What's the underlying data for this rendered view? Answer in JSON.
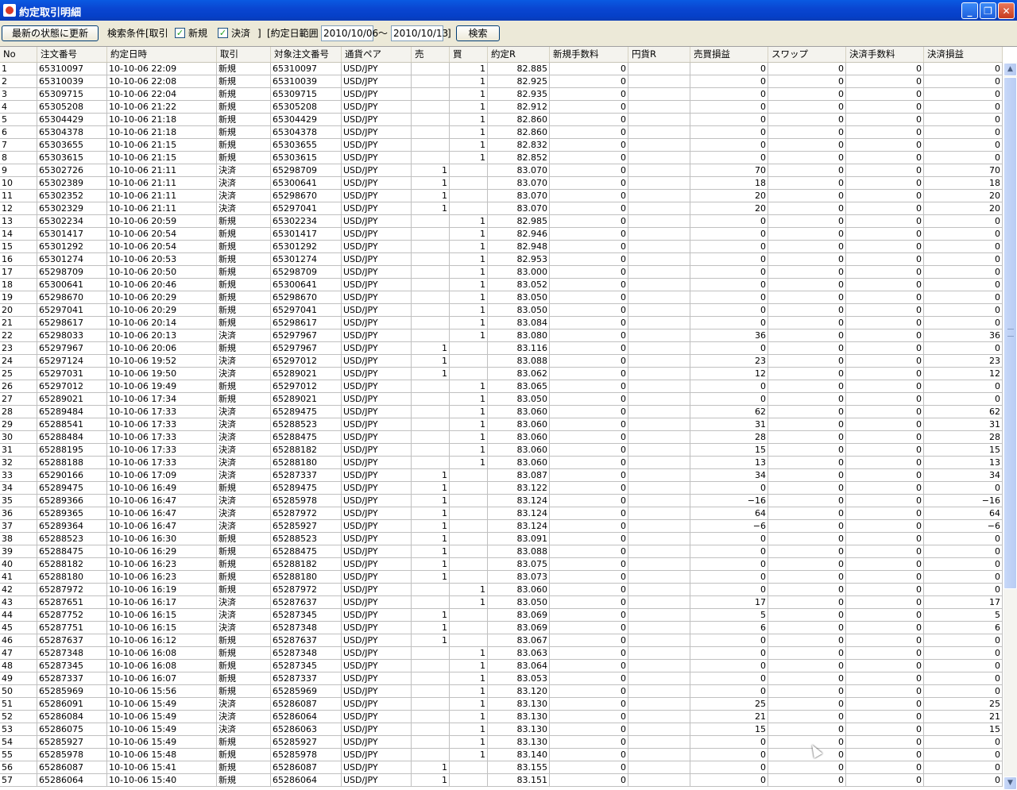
{
  "window": {
    "title": "約定取引明細",
    "minimize": "_",
    "maximize": "❐",
    "close": "✕"
  },
  "toolbar": {
    "refresh_label": "最新の状態に更新",
    "criteria_label": "検索条件[取引",
    "new_label": "新規",
    "settle_label": "決済",
    "bracket_close": "]",
    "date_range_label": "[約定日範囲",
    "date_from": "2010/10/06",
    "tilde": "～",
    "date_to": "2010/10/13",
    "bracket_close2": "]",
    "search_label": "検索"
  },
  "table": {
    "headers": [
      "No",
      "注文番号",
      "約定日時",
      "取引",
      "対象注文番号",
      "通貨ペア",
      "売",
      "買",
      "約定R",
      "新規手数料",
      "円貨R",
      "売買損益",
      "スワップ",
      "決済手数料",
      "決済損益"
    ],
    "rows": [
      [
        "1",
        "65310097",
        "10-10-06 22:09",
        "新規",
        "65310097",
        "USD/JPY",
        "",
        "1",
        "82.885",
        "0",
        "",
        "0",
        "0",
        "0",
        "0"
      ],
      [
        "2",
        "65310039",
        "10-10-06 22:08",
        "新規",
        "65310039",
        "USD/JPY",
        "",
        "1",
        "82.925",
        "0",
        "",
        "0",
        "0",
        "0",
        "0"
      ],
      [
        "3",
        "65309715",
        "10-10-06 22:04",
        "新規",
        "65309715",
        "USD/JPY",
        "",
        "1",
        "82.935",
        "0",
        "",
        "0",
        "0",
        "0",
        "0"
      ],
      [
        "4",
        "65305208",
        "10-10-06 21:22",
        "新規",
        "65305208",
        "USD/JPY",
        "",
        "1",
        "82.912",
        "0",
        "",
        "0",
        "0",
        "0",
        "0"
      ],
      [
        "5",
        "65304429",
        "10-10-06 21:18",
        "新規",
        "65304429",
        "USD/JPY",
        "",
        "1",
        "82.860",
        "0",
        "",
        "0",
        "0",
        "0",
        "0"
      ],
      [
        "6",
        "65304378",
        "10-10-06 21:18",
        "新規",
        "65304378",
        "USD/JPY",
        "",
        "1",
        "82.860",
        "0",
        "",
        "0",
        "0",
        "0",
        "0"
      ],
      [
        "7",
        "65303655",
        "10-10-06 21:15",
        "新規",
        "65303655",
        "USD/JPY",
        "",
        "1",
        "82.832",
        "0",
        "",
        "0",
        "0",
        "0",
        "0"
      ],
      [
        "8",
        "65303615",
        "10-10-06 21:15",
        "新規",
        "65303615",
        "USD/JPY",
        "",
        "1",
        "82.852",
        "0",
        "",
        "0",
        "0",
        "0",
        "0"
      ],
      [
        "9",
        "65302726",
        "10-10-06 21:11",
        "決済",
        "65298709",
        "USD/JPY",
        "1",
        "",
        "83.070",
        "0",
        "",
        "70",
        "0",
        "0",
        "70"
      ],
      [
        "10",
        "65302389",
        "10-10-06 21:11",
        "決済",
        "65300641",
        "USD/JPY",
        "1",
        "",
        "83.070",
        "0",
        "",
        "18",
        "0",
        "0",
        "18"
      ],
      [
        "11",
        "65302352",
        "10-10-06 21:11",
        "決済",
        "65298670",
        "USD/JPY",
        "1",
        "",
        "83.070",
        "0",
        "",
        "20",
        "0",
        "0",
        "20"
      ],
      [
        "12",
        "65302329",
        "10-10-06 21:11",
        "決済",
        "65297041",
        "USD/JPY",
        "1",
        "",
        "83.070",
        "0",
        "",
        "20",
        "0",
        "0",
        "20"
      ],
      [
        "13",
        "65302234",
        "10-10-06 20:59",
        "新規",
        "65302234",
        "USD/JPY",
        "",
        "1",
        "82.985",
        "0",
        "",
        "0",
        "0",
        "0",
        "0"
      ],
      [
        "14",
        "65301417",
        "10-10-06 20:54",
        "新規",
        "65301417",
        "USD/JPY",
        "",
        "1",
        "82.946",
        "0",
        "",
        "0",
        "0",
        "0",
        "0"
      ],
      [
        "15",
        "65301292",
        "10-10-06 20:54",
        "新規",
        "65301292",
        "USD/JPY",
        "",
        "1",
        "82.948",
        "0",
        "",
        "0",
        "0",
        "0",
        "0"
      ],
      [
        "16",
        "65301274",
        "10-10-06 20:53",
        "新規",
        "65301274",
        "USD/JPY",
        "",
        "1",
        "82.953",
        "0",
        "",
        "0",
        "0",
        "0",
        "0"
      ],
      [
        "17",
        "65298709",
        "10-10-06 20:50",
        "新規",
        "65298709",
        "USD/JPY",
        "",
        "1",
        "83.000",
        "0",
        "",
        "0",
        "0",
        "0",
        "0"
      ],
      [
        "18",
        "65300641",
        "10-10-06 20:46",
        "新規",
        "65300641",
        "USD/JPY",
        "",
        "1",
        "83.052",
        "0",
        "",
        "0",
        "0",
        "0",
        "0"
      ],
      [
        "19",
        "65298670",
        "10-10-06 20:29",
        "新規",
        "65298670",
        "USD/JPY",
        "",
        "1",
        "83.050",
        "0",
        "",
        "0",
        "0",
        "0",
        "0"
      ],
      [
        "20",
        "65297041",
        "10-10-06 20:29",
        "新規",
        "65297041",
        "USD/JPY",
        "",
        "1",
        "83.050",
        "0",
        "",
        "0",
        "0",
        "0",
        "0"
      ],
      [
        "21",
        "65298617",
        "10-10-06 20:14",
        "新規",
        "65298617",
        "USD/JPY",
        "",
        "1",
        "83.084",
        "0",
        "",
        "0",
        "0",
        "0",
        "0"
      ],
      [
        "22",
        "65298033",
        "10-10-06 20:13",
        "決済",
        "65297967",
        "USD/JPY",
        "",
        "1",
        "83.080",
        "0",
        "",
        "36",
        "0",
        "0",
        "36"
      ],
      [
        "23",
        "65297967",
        "10-10-06 20:06",
        "新規",
        "65297967",
        "USD/JPY",
        "1",
        "",
        "83.116",
        "0",
        "",
        "0",
        "0",
        "0",
        "0"
      ],
      [
        "24",
        "65297124",
        "10-10-06 19:52",
        "決済",
        "65297012",
        "USD/JPY",
        "1",
        "",
        "83.088",
        "0",
        "",
        "23",
        "0",
        "0",
        "23"
      ],
      [
        "25",
        "65297031",
        "10-10-06 19:50",
        "決済",
        "65289021",
        "USD/JPY",
        "1",
        "",
        "83.062",
        "0",
        "",
        "12",
        "0",
        "0",
        "12"
      ],
      [
        "26",
        "65297012",
        "10-10-06 19:49",
        "新規",
        "65297012",
        "USD/JPY",
        "",
        "1",
        "83.065",
        "0",
        "",
        "0",
        "0",
        "0",
        "0"
      ],
      [
        "27",
        "65289021",
        "10-10-06 17:34",
        "新規",
        "65289021",
        "USD/JPY",
        "",
        "1",
        "83.050",
        "0",
        "",
        "0",
        "0",
        "0",
        "0"
      ],
      [
        "28",
        "65289484",
        "10-10-06 17:33",
        "決済",
        "65289475",
        "USD/JPY",
        "",
        "1",
        "83.060",
        "0",
        "",
        "62",
        "0",
        "0",
        "62"
      ],
      [
        "29",
        "65288541",
        "10-10-06 17:33",
        "決済",
        "65288523",
        "USD/JPY",
        "",
        "1",
        "83.060",
        "0",
        "",
        "31",
        "0",
        "0",
        "31"
      ],
      [
        "30",
        "65288484",
        "10-10-06 17:33",
        "決済",
        "65288475",
        "USD/JPY",
        "",
        "1",
        "83.060",
        "0",
        "",
        "28",
        "0",
        "0",
        "28"
      ],
      [
        "31",
        "65288195",
        "10-10-06 17:33",
        "決済",
        "65288182",
        "USD/JPY",
        "",
        "1",
        "83.060",
        "0",
        "",
        "15",
        "0",
        "0",
        "15"
      ],
      [
        "32",
        "65288188",
        "10-10-06 17:33",
        "決済",
        "65288180",
        "USD/JPY",
        "",
        "1",
        "83.060",
        "0",
        "",
        "13",
        "0",
        "0",
        "13"
      ],
      [
        "33",
        "65290166",
        "10-10-06 17:09",
        "決済",
        "65287337",
        "USD/JPY",
        "1",
        "",
        "83.087",
        "0",
        "",
        "34",
        "0",
        "0",
        "34"
      ],
      [
        "34",
        "65289475",
        "10-10-06 16:49",
        "新規",
        "65289475",
        "USD/JPY",
        "1",
        "",
        "83.122",
        "0",
        "",
        "0",
        "0",
        "0",
        "0"
      ],
      [
        "35",
        "65289366",
        "10-10-06 16:47",
        "決済",
        "65285978",
        "USD/JPY",
        "1",
        "",
        "83.124",
        "0",
        "",
        "−16",
        "0",
        "0",
        "−16"
      ],
      [
        "36",
        "65289365",
        "10-10-06 16:47",
        "決済",
        "65287972",
        "USD/JPY",
        "1",
        "",
        "83.124",
        "0",
        "",
        "64",
        "0",
        "0",
        "64"
      ],
      [
        "37",
        "65289364",
        "10-10-06 16:47",
        "決済",
        "65285927",
        "USD/JPY",
        "1",
        "",
        "83.124",
        "0",
        "",
        "−6",
        "0",
        "0",
        "−6"
      ],
      [
        "38",
        "65288523",
        "10-10-06 16:30",
        "新規",
        "65288523",
        "USD/JPY",
        "1",
        "",
        "83.091",
        "0",
        "",
        "0",
        "0",
        "0",
        "0"
      ],
      [
        "39",
        "65288475",
        "10-10-06 16:29",
        "新規",
        "65288475",
        "USD/JPY",
        "1",
        "",
        "83.088",
        "0",
        "",
        "0",
        "0",
        "0",
        "0"
      ],
      [
        "40",
        "65288182",
        "10-10-06 16:23",
        "新規",
        "65288182",
        "USD/JPY",
        "1",
        "",
        "83.075",
        "0",
        "",
        "0",
        "0",
        "0",
        "0"
      ],
      [
        "41",
        "65288180",
        "10-10-06 16:23",
        "新規",
        "65288180",
        "USD/JPY",
        "1",
        "",
        "83.073",
        "0",
        "",
        "0",
        "0",
        "0",
        "0"
      ],
      [
        "42",
        "65287972",
        "10-10-06 16:19",
        "新規",
        "65287972",
        "USD/JPY",
        "",
        "1",
        "83.060",
        "0",
        "",
        "0",
        "0",
        "0",
        "0"
      ],
      [
        "43",
        "65287651",
        "10-10-06 16:17",
        "決済",
        "65287637",
        "USD/JPY",
        "",
        "1",
        "83.050",
        "0",
        "",
        "17",
        "0",
        "0",
        "17"
      ],
      [
        "44",
        "65287752",
        "10-10-06 16:15",
        "決済",
        "65287345",
        "USD/JPY",
        "1",
        "",
        "83.069",
        "0",
        "",
        "5",
        "0",
        "0",
        "5"
      ],
      [
        "45",
        "65287751",
        "10-10-06 16:15",
        "決済",
        "65287348",
        "USD/JPY",
        "1",
        "",
        "83.069",
        "0",
        "",
        "6",
        "0",
        "0",
        "6"
      ],
      [
        "46",
        "65287637",
        "10-10-06 16:12",
        "新規",
        "65287637",
        "USD/JPY",
        "1",
        "",
        "83.067",
        "0",
        "",
        "0",
        "0",
        "0",
        "0"
      ],
      [
        "47",
        "65287348",
        "10-10-06 16:08",
        "新規",
        "65287348",
        "USD/JPY",
        "",
        "1",
        "83.063",
        "0",
        "",
        "0",
        "0",
        "0",
        "0"
      ],
      [
        "48",
        "65287345",
        "10-10-06 16:08",
        "新規",
        "65287345",
        "USD/JPY",
        "",
        "1",
        "83.064",
        "0",
        "",
        "0",
        "0",
        "0",
        "0"
      ],
      [
        "49",
        "65287337",
        "10-10-06 16:07",
        "新規",
        "65287337",
        "USD/JPY",
        "",
        "1",
        "83.053",
        "0",
        "",
        "0",
        "0",
        "0",
        "0"
      ],
      [
        "50",
        "65285969",
        "10-10-06 15:56",
        "新規",
        "65285969",
        "USD/JPY",
        "",
        "1",
        "83.120",
        "0",
        "",
        "0",
        "0",
        "0",
        "0"
      ],
      [
        "51",
        "65286091",
        "10-10-06 15:49",
        "決済",
        "65286087",
        "USD/JPY",
        "",
        "1",
        "83.130",
        "0",
        "",
        "25",
        "0",
        "0",
        "25"
      ],
      [
        "52",
        "65286084",
        "10-10-06 15:49",
        "決済",
        "65286064",
        "USD/JPY",
        "",
        "1",
        "83.130",
        "0",
        "",
        "21",
        "0",
        "0",
        "21"
      ],
      [
        "53",
        "65286075",
        "10-10-06 15:49",
        "決済",
        "65286063",
        "USD/JPY",
        "",
        "1",
        "83.130",
        "0",
        "",
        "15",
        "0",
        "0",
        "15"
      ],
      [
        "54",
        "65285927",
        "10-10-06 15:49",
        "新規",
        "65285927",
        "USD/JPY",
        "",
        "1",
        "83.130",
        "0",
        "",
        "0",
        "0",
        "0",
        "0"
      ],
      [
        "55",
        "65285978",
        "10-10-06 15:48",
        "新規",
        "65285978",
        "USD/JPY",
        "",
        "1",
        "83.140",
        "0",
        "",
        "0",
        "0",
        "0",
        "0"
      ],
      [
        "56",
        "65286087",
        "10-10-06 15:41",
        "新規",
        "65286087",
        "USD/JPY",
        "1",
        "",
        "83.155",
        "0",
        "",
        "0",
        "0",
        "0",
        "0"
      ],
      [
        "57",
        "65286064",
        "10-10-06 15:40",
        "新規",
        "65286064",
        "USD/JPY",
        "1",
        "",
        "83.151",
        "0",
        "",
        "0",
        "0",
        "0",
        "0"
      ]
    ]
  }
}
